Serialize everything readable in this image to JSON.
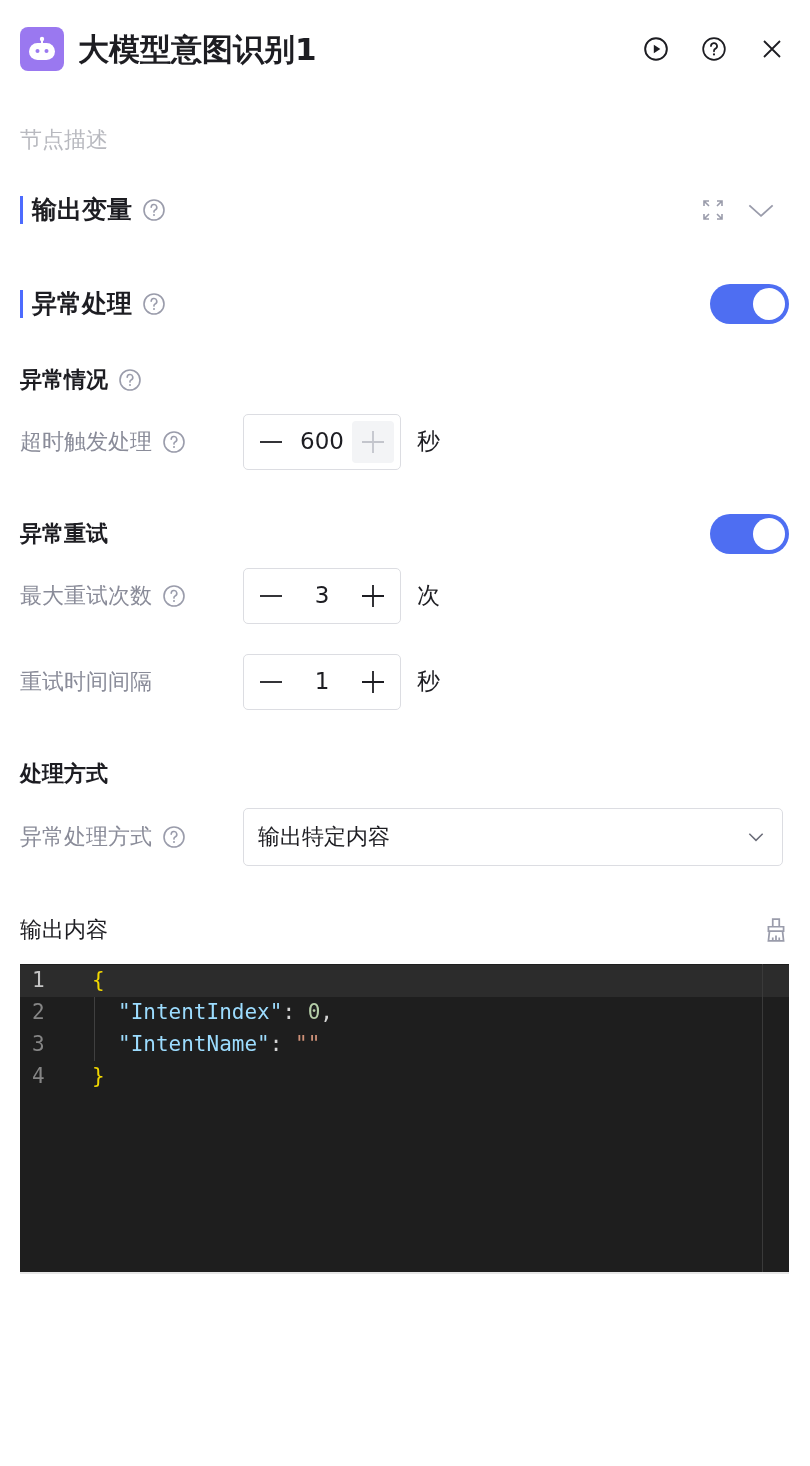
{
  "header": {
    "title": "大模型意图识别1",
    "description_placeholder": "节点描述"
  },
  "output_section": {
    "title": "输出变量",
    "expanded": false
  },
  "error_section": {
    "title": "异常处理",
    "on": true
  },
  "groups": [
    {
      "kind": "stepper_group",
      "title": "异常情况",
      "help": true,
      "rows": [
        {
          "label": "超时触发处理",
          "help": true,
          "value": "600",
          "unit": "秒",
          "minus_disabled": false,
          "plus_disabled": true
        }
      ]
    },
    {
      "kind": "stepper_group",
      "title": "异常重试",
      "help": false,
      "toggle": true,
      "rows": [
        {
          "label": "最大重试次数",
          "help": true,
          "value": "3",
          "unit": "次",
          "minus_disabled": false,
          "plus_disabled": false
        },
        {
          "label": "重试时间间隔",
          "help": false,
          "value": "1",
          "unit": "秒",
          "minus_disabled": false,
          "plus_disabled": false
        }
      ]
    },
    {
      "kind": "select_group",
      "title": "处理方式",
      "help": false,
      "rows": [
        {
          "label": "异常处理方式",
          "help": true,
          "value": "输出特定内容"
        }
      ]
    }
  ],
  "output_content": {
    "label": "输出内容",
    "lines": [
      {
        "number": "1",
        "indented": false,
        "current": true,
        "tokens": [
          {
            "kind": "brace",
            "text": "{"
          }
        ]
      },
      {
        "number": "2",
        "indented": true,
        "current": false,
        "tokens": [
          {
            "kind": "key",
            "text": "\"IntentIndex\""
          },
          {
            "kind": "punct",
            "text": ": "
          },
          {
            "kind": "number",
            "text": "0"
          },
          {
            "kind": "punct",
            "text": ","
          }
        ]
      },
      {
        "number": "3",
        "indented": true,
        "current": false,
        "tokens": [
          {
            "kind": "key",
            "text": "\"IntentName\""
          },
          {
            "kind": "punct",
            "text": ": "
          },
          {
            "kind": "string",
            "text": "\"\""
          }
        ]
      },
      {
        "number": "4",
        "indented": false,
        "current": false,
        "tokens": [
          {
            "kind": "brace",
            "text": "}"
          }
        ]
      }
    ]
  }
}
